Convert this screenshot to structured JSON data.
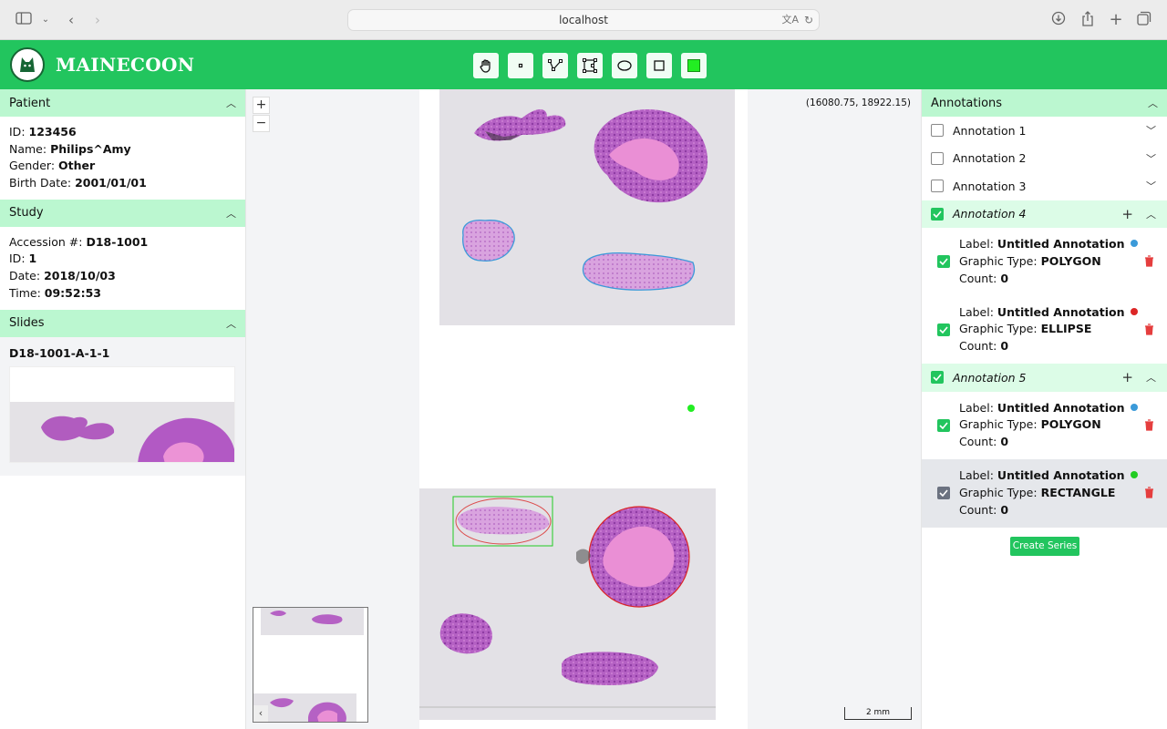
{
  "browser": {
    "url": "localhost"
  },
  "app": {
    "title": "MAINECOON"
  },
  "toolbar": {
    "tools": [
      "pan-tool",
      "point-tool",
      "polyline-tool",
      "polygon-tool",
      "ellipse-tool",
      "rectangle-tool",
      "color-tool"
    ],
    "active_color": "#22ee22"
  },
  "patient": {
    "title": "Patient",
    "id_label": "ID",
    "id": "123456",
    "name_label": "Name",
    "name": "Philips^Amy",
    "gender_label": "Gender",
    "gender": "Other",
    "birth_label": "Birth Date",
    "birth": "2001/01/01"
  },
  "study": {
    "title": "Study",
    "accession_label": "Accession #",
    "accession": "D18-1001",
    "id_label": "ID",
    "id": "1",
    "date_label": "Date",
    "date": "2018/10/03",
    "time_label": "Time",
    "time": "09:52:53"
  },
  "slides": {
    "title": "Slides",
    "items": [
      {
        "name": "D18-1001-A-1-1"
      }
    ]
  },
  "viewer": {
    "zoom_in": "+",
    "zoom_out": "−",
    "coordinates": "(16080.75, 18922.15)",
    "scale": "2 mm",
    "overview_back": "‹"
  },
  "annotations": {
    "title": "Annotations",
    "groups": [
      {
        "label": "Annotation 1",
        "checked": false
      },
      {
        "label": "Annotation 2",
        "checked": false
      },
      {
        "label": "Annotation 3",
        "checked": false
      },
      {
        "label": "Annotation 4",
        "checked": true,
        "items": [
          {
            "label_key": "Label",
            "label": "Untitled Annotation",
            "type_key": "Graphic Type",
            "type": "POLYGON",
            "count_key": "Count",
            "count": "0",
            "color": "#3b9ad9"
          },
          {
            "label_key": "Label",
            "label": "Untitled Annotation",
            "type_key": "Graphic Type",
            "type": "ELLIPSE",
            "count_key": "Count",
            "count": "0",
            "color": "#dc2626"
          }
        ]
      },
      {
        "label": "Annotation 5",
        "checked": true,
        "items": [
          {
            "label_key": "Label",
            "label": "Untitled Annotation",
            "type_key": "Graphic Type",
            "type": "POLYGON",
            "count_key": "Count",
            "count": "0",
            "color": "#3b9ad9"
          },
          {
            "label_key": "Label",
            "label": "Untitled Annotation",
            "type_key": "Graphic Type",
            "type": "RECTANGLE",
            "count_key": "Count",
            "count": "0",
            "color": "#22cc22"
          }
        ]
      }
    ],
    "create_label": "Create Series"
  }
}
